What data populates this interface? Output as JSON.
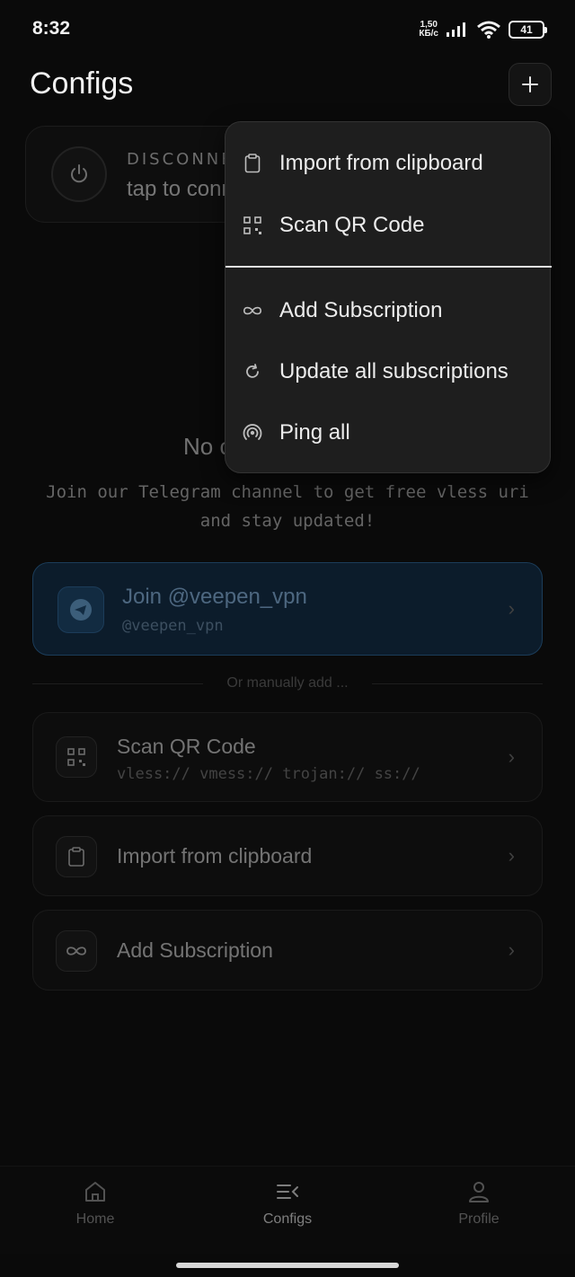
{
  "status": {
    "time": "8:32",
    "net_speed_value": "1,50",
    "net_speed_unit": "КБ/с",
    "battery": "41"
  },
  "header": {
    "title": "Configs"
  },
  "connection": {
    "status": "DISCONNECTED",
    "hint": "tap to connect"
  },
  "empty": {
    "title": "No configs",
    "description": "Join our Telegram channel to get free vless uri and stay updated!"
  },
  "telegram": {
    "title": "Join @veepen_vpn",
    "handle": "@veepen_vpn"
  },
  "divider": "Or manually add ...",
  "options": [
    {
      "title": "Scan QR Code",
      "subtitle": "vless:// vmess:// trojan:// ss://"
    },
    {
      "title": "Import from clipboard"
    },
    {
      "title": "Add Subscription"
    }
  ],
  "menu": {
    "items": [
      {
        "label": "Import from clipboard",
        "icon": "clipboard-icon"
      },
      {
        "label": "Scan QR Code",
        "icon": "qr-code-icon"
      },
      {
        "label": "Add Subscription",
        "icon": "infinity-icon"
      },
      {
        "label": "Update all subscriptions",
        "icon": "refresh-icon"
      },
      {
        "label": "Ping all",
        "icon": "ping-icon"
      }
    ]
  },
  "nav": {
    "items": [
      {
        "label": "Home",
        "icon": "home-icon",
        "active": false
      },
      {
        "label": "Configs",
        "icon": "configs-icon",
        "active": true
      },
      {
        "label": "Profile",
        "icon": "profile-icon",
        "active": false
      }
    ]
  },
  "colors": {
    "background": "#0a0a0a",
    "accent_blue": "#8fc4f5",
    "menu_bg": "#1e1e1e"
  }
}
